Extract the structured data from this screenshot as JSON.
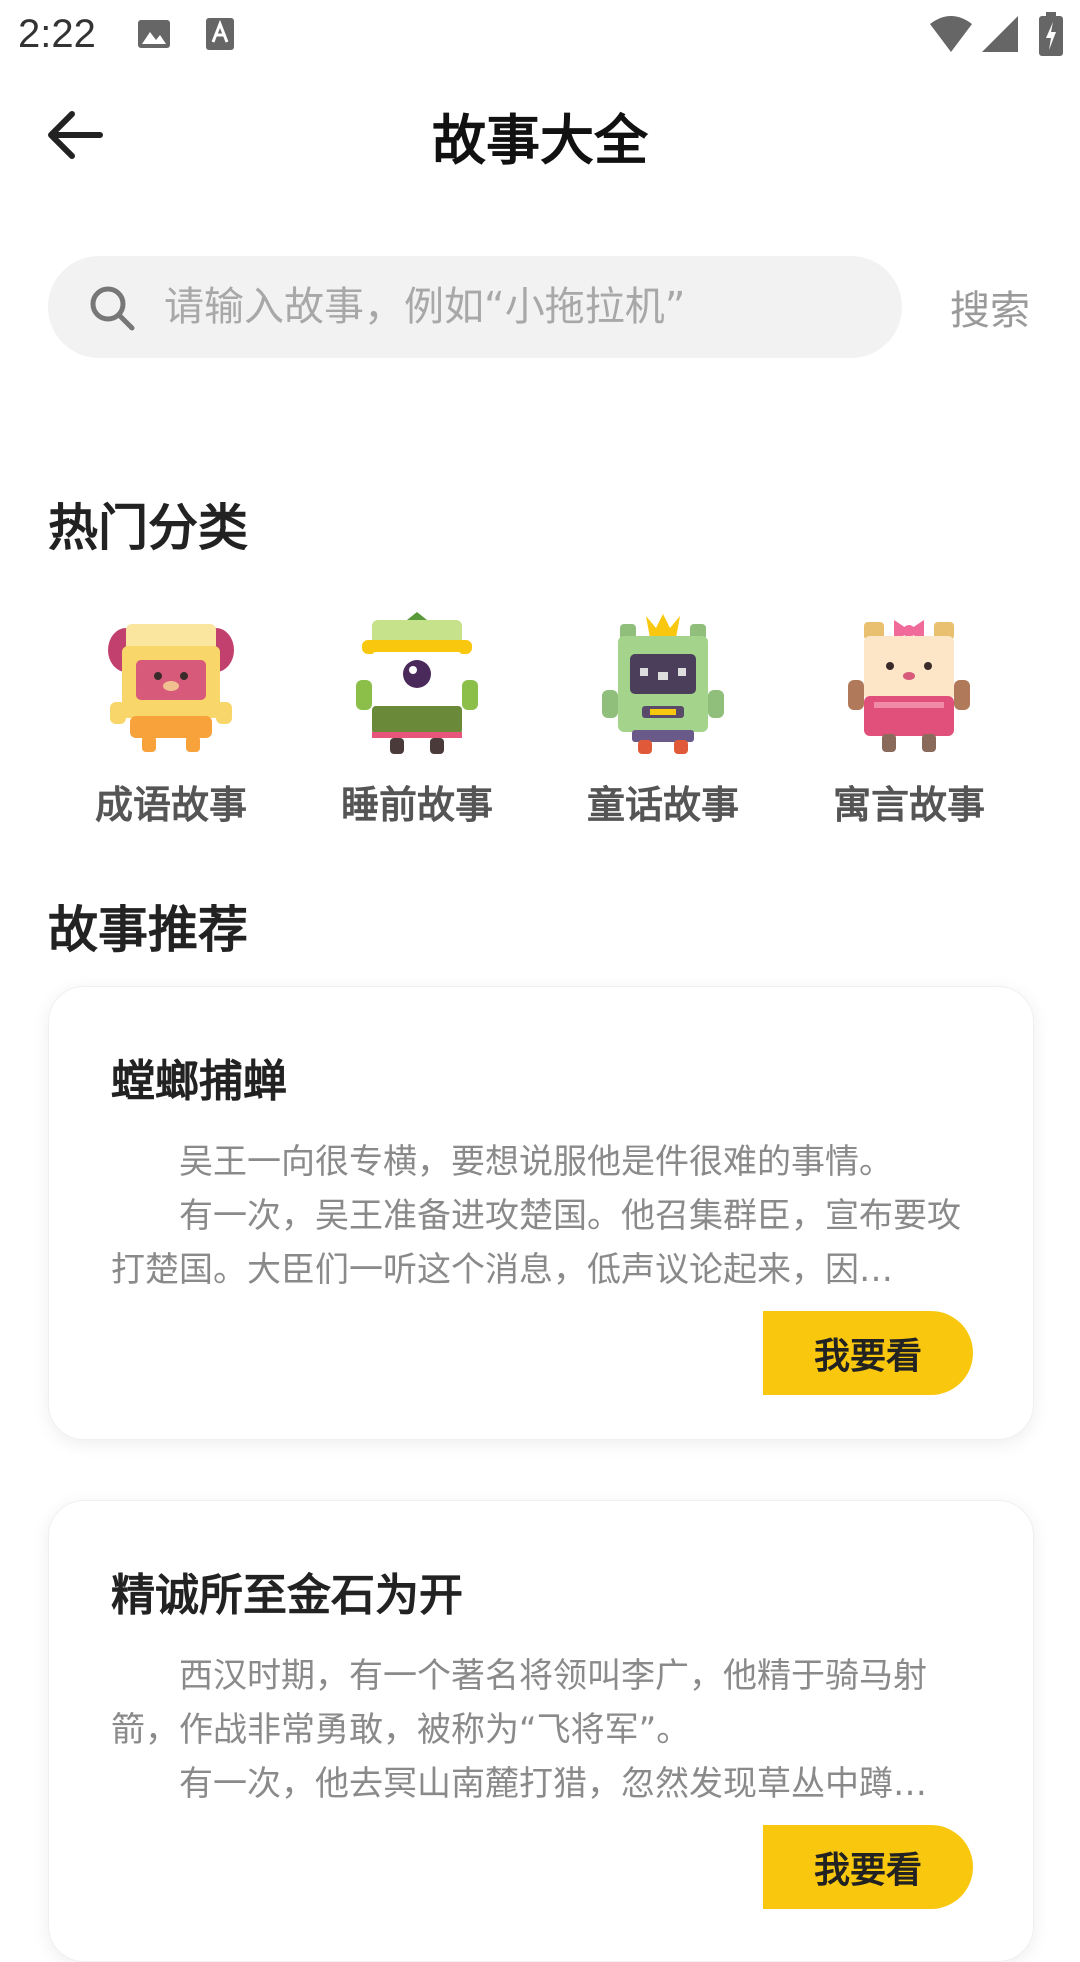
{
  "status_bar": {
    "time": "2:22"
  },
  "header": {
    "title": "故事大全"
  },
  "search": {
    "placeholder": "请输入故事，例如“小拖拉机”",
    "value": "",
    "button_label": "搜索"
  },
  "hot_categories": {
    "title": "热门分类",
    "items": [
      {
        "label": "成语故事",
        "icon": "yellow-bear-robot-icon"
      },
      {
        "label": "睡前故事",
        "icon": "green-cyclops-robot-icon"
      },
      {
        "label": "童话故事",
        "icon": "crowned-green-robot-icon"
      },
      {
        "label": "寓言故事",
        "icon": "pink-bow-robot-icon"
      }
    ]
  },
  "recommend": {
    "title": "故事推荐",
    "stories": [
      {
        "title": "螳螂捕蝉",
        "paragraphs": [
          "吴王一向很专横，要想说服他是件很难的事情。",
          "有一次，吴王准备进攻楚国。他召集群臣，宣布要攻打楚国。大臣们一听这个消息，低声议论起来，因…"
        ],
        "button_label": "我要看"
      },
      {
        "title": "精诚所至金石为开",
        "paragraphs": [
          "西汉时期，有一个著名将领叫李广，他精于骑马射箭，作战非常勇敢，被称为“飞将军”。",
          "有一次，他去冥山南麓打猎，忽然发现草丛中蹲…"
        ],
        "button_label": "我要看"
      }
    ]
  },
  "colors": {
    "accent": "#f9c80e",
    "search_bg": "#f2f2f2"
  }
}
